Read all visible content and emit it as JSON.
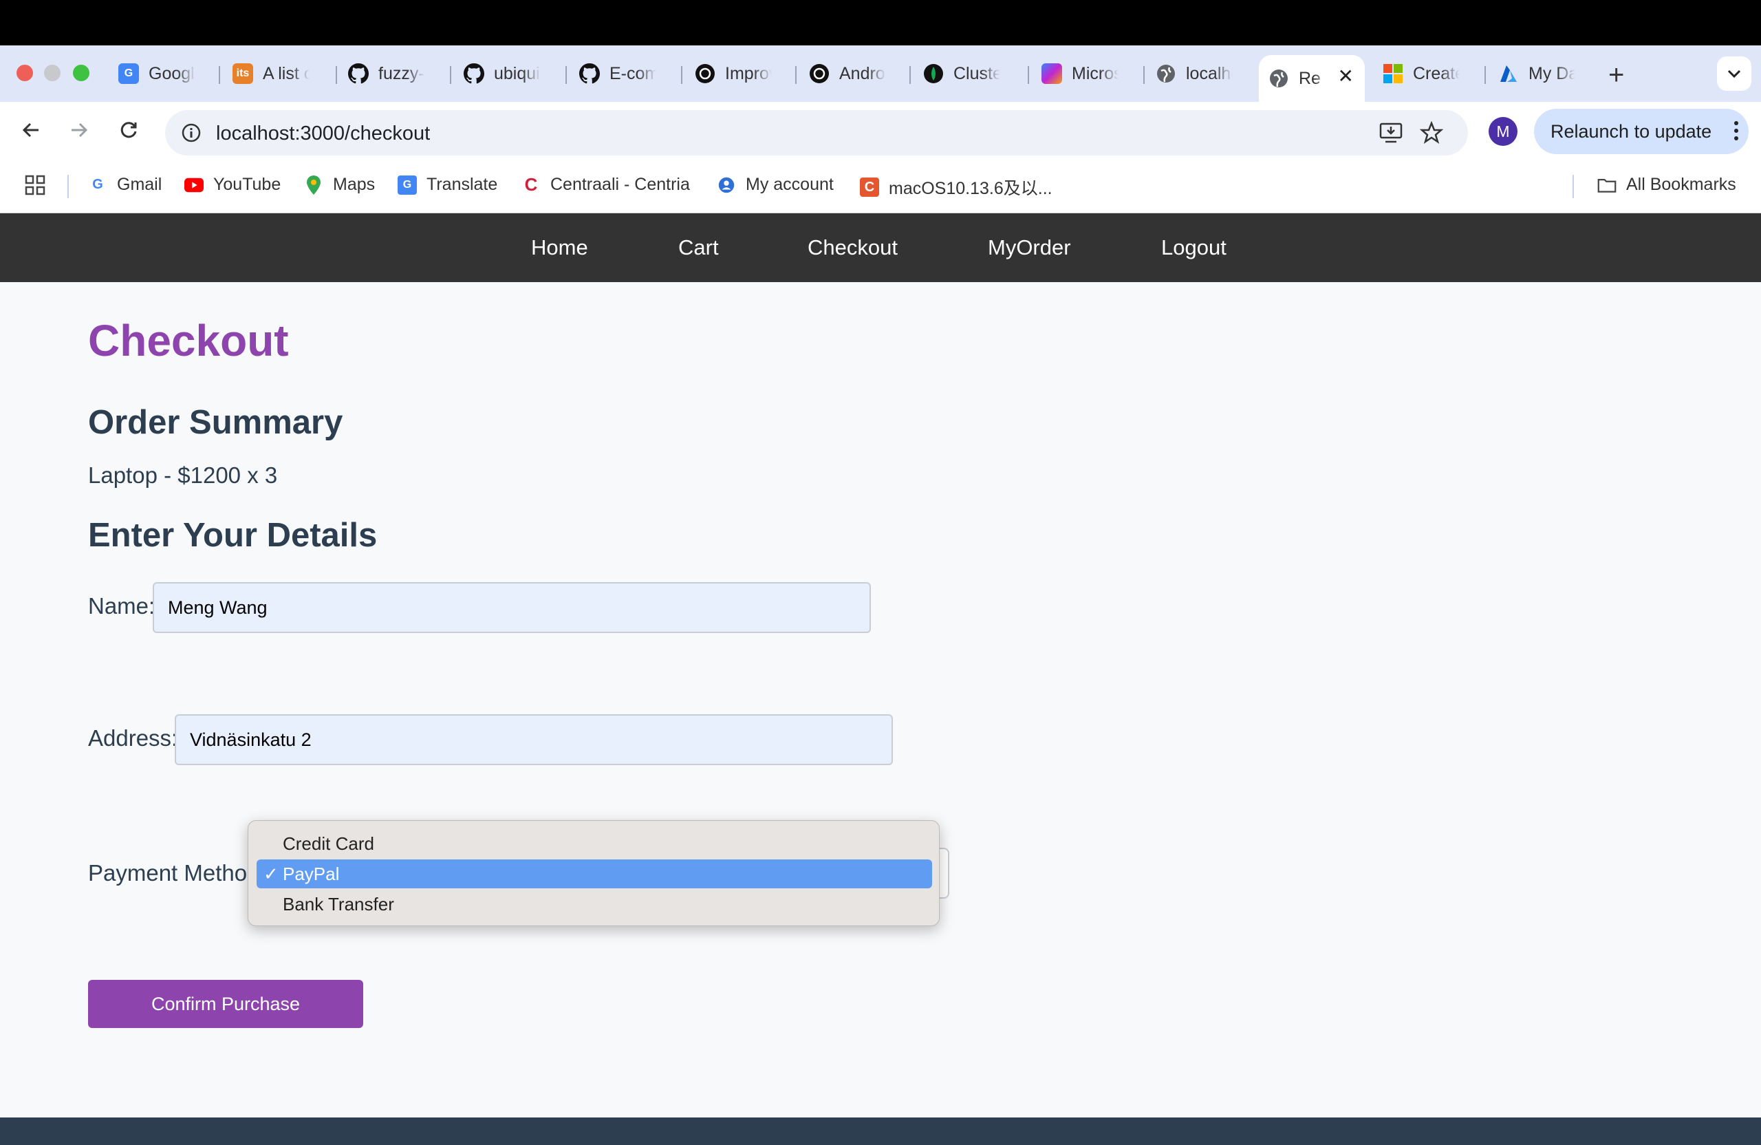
{
  "browser": {
    "tabs": [
      {
        "title": "Google",
        "icon": "google-translate-icon",
        "color": "#4285f4"
      },
      {
        "title": "A list of",
        "icon": "its-icon",
        "color": "#e8802a"
      },
      {
        "title": "fuzzy-",
        "icon": "github-icon",
        "color": "#111111"
      },
      {
        "title": "ubiquit",
        "icon": "github-icon",
        "color": "#111111"
      },
      {
        "title": "E-comm",
        "icon": "github-icon",
        "color": "#111111"
      },
      {
        "title": "Improv",
        "icon": "openai-icon",
        "color": "#111111"
      },
      {
        "title": "Androi",
        "icon": "openai-icon",
        "color": "#111111"
      },
      {
        "title": "Cluste",
        "icon": "mongodb-leaf-icon",
        "color": "#13aa52"
      },
      {
        "title": "Micros",
        "icon": "copilot-icon",
        "color": "#7a5cf0"
      },
      {
        "title": "localho",
        "icon": "globe-icon",
        "color": "#5f6368"
      },
      {
        "title": "Re",
        "icon": "globe-icon",
        "color": "#5f6368",
        "active": true
      },
      {
        "title": "Create",
        "icon": "microsoft-icon",
        "color": "#f25022"
      },
      {
        "title": "My Da",
        "icon": "azure-icon",
        "color": "#0078d4"
      }
    ],
    "url": "localhost:3000/checkout",
    "profile_initial": "M",
    "relaunch_label": "Relaunch to update",
    "bookmarks": [
      {
        "label": "Gmail",
        "icon": "google-icon"
      },
      {
        "label": "YouTube",
        "icon": "youtube-icon"
      },
      {
        "label": "Maps",
        "icon": "maps-pin-icon"
      },
      {
        "label": "Translate",
        "icon": "translate-icon"
      },
      {
        "label": "Centraali - Centria",
        "icon": "centria-icon"
      },
      {
        "label": "My account",
        "icon": "account-icon"
      },
      {
        "label": "macOS10.13.6及以...",
        "icon": "c-icon"
      }
    ],
    "all_bookmarks_label": "All Bookmarks"
  },
  "site": {
    "nav": [
      "Home",
      "Cart",
      "Checkout",
      "MyOrder",
      "Logout"
    ],
    "title": "Checkout",
    "order_summary_heading": "Order Summary",
    "items": [
      "Laptop - $1200 x 3"
    ],
    "details_heading": "Enter Your Details",
    "form": {
      "name_label": "Name:",
      "name_value": "Meng Wang",
      "address_label": "Address:",
      "address_value": "Vidnäsinkatu 2",
      "payment_label": "Payment Method:",
      "payment_options": [
        "Credit Card",
        "PayPal",
        "Bank Transfer"
      ],
      "payment_selected": "PayPal",
      "confirm_label": "Confirm Purchase"
    }
  },
  "colors": {
    "accent": "#8e44ad",
    "nav_bg": "#333333",
    "heading": "#2c3e50",
    "selected_option": "#5f9cf2"
  }
}
